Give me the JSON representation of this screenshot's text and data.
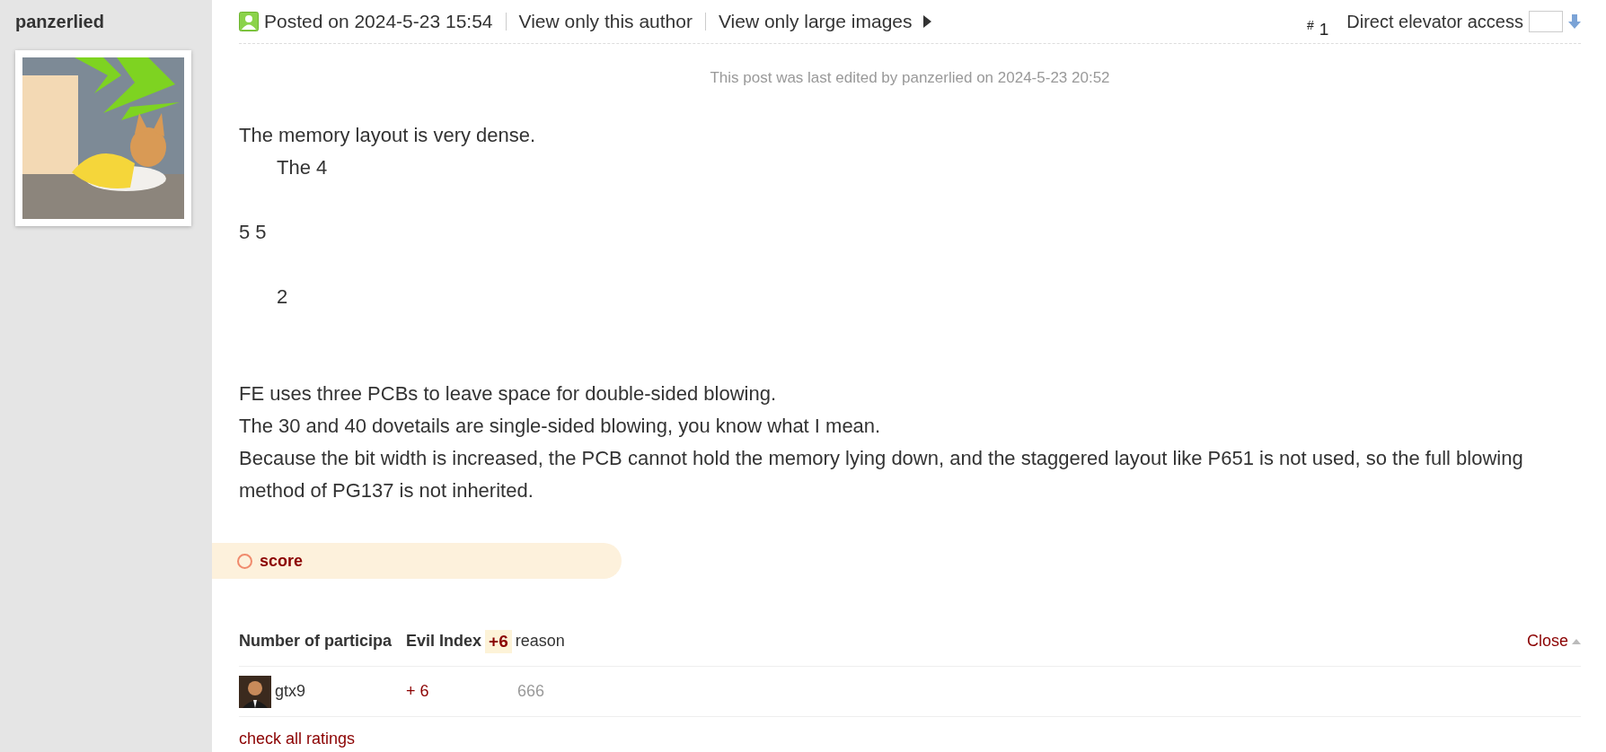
{
  "author": {
    "name": "panzerlied"
  },
  "post_header": {
    "posted": "Posted on 2024-5-23 15:54",
    "links": [
      "View only this author",
      "View only large images"
    ],
    "floor": {
      "mark": "#",
      "number": "1"
    },
    "jump": {
      "label": "Direct elevator access"
    }
  },
  "edit_note": "This post was last edited by panzerlied on 2024-5-23 20:52",
  "body": [
    {
      "kind": "text",
      "text": "The memory layout is very dense.",
      "indented": false
    },
    {
      "kind": "text",
      "text": "The 4",
      "indented": true
    },
    {
      "kind": "blank"
    },
    {
      "kind": "text",
      "text": "5 5",
      "indented": false
    },
    {
      "kind": "blank"
    },
    {
      "kind": "text",
      "text": "2",
      "indented": true
    },
    {
      "kind": "blank"
    },
    {
      "kind": "blank"
    },
    {
      "kind": "text",
      "text": "FE uses three PCBs to leave space for double-sided blowing.",
      "indented": false
    },
    {
      "kind": "text",
      "text": "The 30 and 40 dovetails are single-sided blowing, you know what I mean.",
      "indented": false
    },
    {
      "kind": "text",
      "text": "Because the bit width is increased, the PCB cannot hold the memory lying down, and the staggered layout like P651 is not used, so the full blowing method of PG137 is not inherited.",
      "indented": false
    }
  ],
  "rating": {
    "title": "score",
    "columns": [
      "Number of participa",
      "Evil Index",
      "reason"
    ],
    "total": "+6",
    "close": "Close",
    "rows": [
      {
        "user": "gtx9",
        "score": "+ 6",
        "reason": "666"
      }
    ],
    "link": "check all ratings"
  }
}
